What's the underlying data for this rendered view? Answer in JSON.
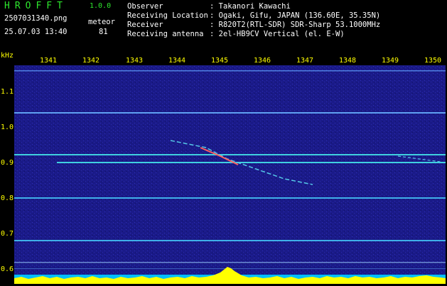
{
  "header": {
    "logo": "HROFFT",
    "version": "1.0.0",
    "filename": "2507031340.png",
    "datetime": "25.07.03 13:40",
    "mode": "meteor",
    "count": "81",
    "info": [
      {
        "key": "Observer",
        "value": ": Takanori Kawachi"
      },
      {
        "key": "Receiving Location",
        "value": ": Ogaki, Gifu, JAPAN (136.60E, 35.35N)"
      },
      {
        "key": "Receiver",
        "value": ": R820T2(RTL-SDR) SDR-Sharp 53.1000MHz"
      },
      {
        "key": "Receiving antenna",
        "value": ": 2el-HB9CV Vertical (el. E-W)"
      }
    ]
  },
  "axis": {
    "unit": "kHz",
    "x_ticks": [
      "1341",
      "1342",
      "1343",
      "1344",
      "1345",
      "1346",
      "1347",
      "1348",
      "1349",
      "1350"
    ],
    "y_ticks": [
      "1.1",
      "1.0",
      "0.9",
      "0.8",
      "0.7",
      "0.6"
    ]
  },
  "colors": {
    "background": "#1a1a88",
    "axis_text": "#ffff00",
    "logo": "#2ee82e",
    "carrier": "#3fd0e0",
    "power_bar": "#ffff00",
    "power_base": "#00bfff"
  }
}
